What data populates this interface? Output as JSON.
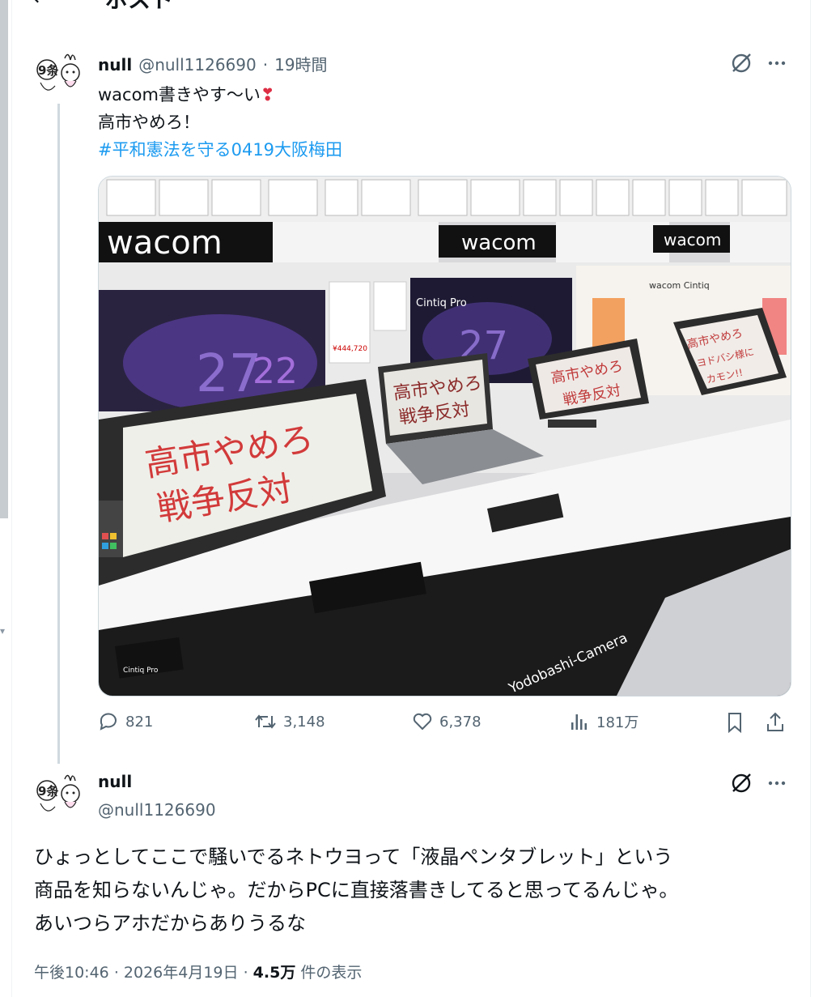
{
  "header": {
    "back_icon": "arrow-left-icon",
    "title": "ポスト"
  },
  "tweet1": {
    "name": "null",
    "handle": "@null1126690",
    "separator": "·",
    "time": "19時間",
    "line1": "wacom書きやす〜い",
    "emoji": "❣",
    "line2": "高市やめろ！",
    "hashtag": "#平和憲法を守る0419大阪梅田",
    "actions": {
      "reply_count": "821",
      "retweet_count": "3,148",
      "like_count": "6,378",
      "views_count": "181万"
    },
    "image": {
      "signs": {
        "left_line1": "高市やめろ",
        "left_line2": "戦争反対",
        "laptop_line1": "高市やめろ",
        "laptop_line2": "戦争反対",
        "mid_line1": "高市やめろ",
        "mid_line2": "戦争反対",
        "right_line1": "高市やめろ",
        "right_line2": "ヨドバシ様に",
        "right_line3": "カモン!!"
      },
      "brand_texts": [
        "wacom",
        "wacom",
        "wacom"
      ],
      "cintiq_label": "Cintiq Pro",
      "wacom_cintiq_label": "wacom Cintiq",
      "price_tag": "¥444,720",
      "store_banner": "Yodobashi-Camera",
      "box_label": "Cintiq Pro"
    }
  },
  "tweet2": {
    "name": "null",
    "handle": "@null1126690",
    "body_line1": "ひょっとしてここで騒いでるネトウヨって「液晶ペンタブレット」という",
    "body_line2": "商品を知らないんじゃ。だからPCに直接落書きしてると思ってるんじゃ。",
    "body_line3": "あいつらアホだからありうるな",
    "time": "午後10:46",
    "separator1": "·",
    "date": "2026年4月19日",
    "separator2": "·",
    "views": "4.5万",
    "views_label": "件の表示"
  }
}
